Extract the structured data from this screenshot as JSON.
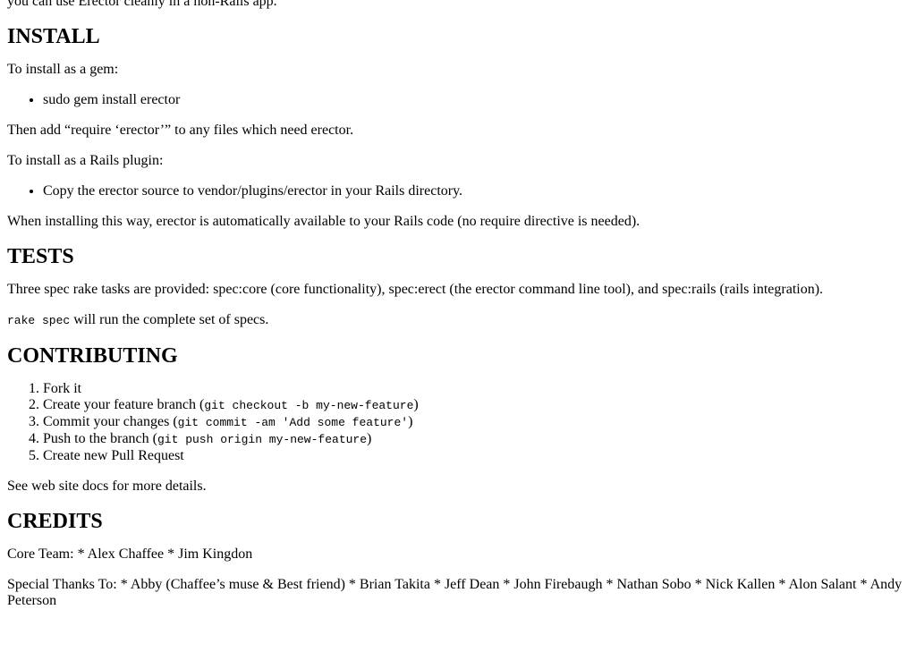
{
  "intro": "you can use Erector cleanly in a non-Rails app.",
  "install": {
    "heading": "INSTALL",
    "gem_intro": "To install as a gem:",
    "gem_items": [
      "sudo gem install erector"
    ],
    "after_gem": "Then add “require ‘erector’” to any files which need erector.",
    "plugin_intro": "To install as a Rails plugin:",
    "plugin_items": [
      "Copy the erector source to vendor/plugins/erector in your Rails directory."
    ],
    "plugin_note": "When installing this way, erector is automatically available to your Rails code (no require directive is needed)."
  },
  "tests": {
    "heading": "TESTS",
    "desc": "Three spec rake tasks are provided: spec:core (core functionality), spec:erect (the erector command line tool), and spec:rails (rails integration).",
    "rake_code": "rake spec",
    "rake_text": " will run the complete set of specs."
  },
  "contributing": {
    "heading": "CONTRIBUTING",
    "steps": [
      {
        "text": "Fork it",
        "code": "",
        "suffix": ""
      },
      {
        "text": "Create your feature branch (",
        "code": "git checkout -b my-new-feature",
        "suffix": ")"
      },
      {
        "text": "Commit your changes (",
        "code": "git commit -am 'Add some feature'",
        "suffix": ")"
      },
      {
        "text": "Push to the branch (",
        "code": "git push origin my-new-feature",
        "suffix": ")"
      },
      {
        "text": "Create new Pull Request",
        "code": "",
        "suffix": ""
      }
    ],
    "see_docs": "See web site docs for more details."
  },
  "credits": {
    "heading": "CREDITS",
    "core_team": "Core Team: * Alex Chaffee * Jim Kingdon",
    "special_thanks": "Special Thanks To: * Abby (Chaffee’s muse & Best friend) * Brian Takita * Jeff Dean * John Firebaugh * Nathan Sobo * Nick Kallen * Alon Salant * Andy Peterson"
  }
}
